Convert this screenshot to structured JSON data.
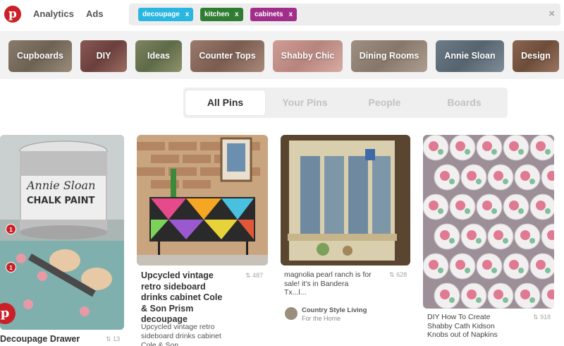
{
  "header": {
    "nav": [
      "Analytics",
      "Ads"
    ],
    "search_chips": [
      {
        "label": "decoupage",
        "color": "#29b6e0"
      },
      {
        "label": "kitchen",
        "color": "#2f7d32"
      },
      {
        "label": "cabinets",
        "color": "#a22e8c"
      }
    ],
    "chip_remove": "x",
    "clear": "×"
  },
  "guides": [
    "Cupboards",
    "DIY",
    "Ideas",
    "Counter Tops",
    "Shabby Chic",
    "Dining Rooms",
    "Annie Sloan",
    "Design"
  ],
  "tabs": [
    "All Pins",
    "Your Pins",
    "People",
    "Boards"
  ],
  "pins": [
    {
      "title": "Decoupage Drawer",
      "count": "13",
      "badges": [
        "1",
        "1"
      ],
      "paint_can": {
        "line1": "Annie Sloan",
        "line2": "CHALK PAINT"
      }
    },
    {
      "title": "Upcycled vintage retro sideboard drinks cabinet Cole & Son Prism decoupage",
      "count": "487",
      "desc": "Upcycled vintage retro sideboard drinks cabinet Cole & Son"
    },
    {
      "title": "magnolia pearl ranch is for sale! it's in Bandera Tx...l...",
      "count": "628",
      "board": "Country Style Living",
      "board_sub": "For the Home"
    },
    {
      "title": "DIY How To Create Shabby Cath Kidson Knobs out of Napkins",
      "count": "918"
    }
  ],
  "colors": {
    "pinterest_red": "#cb2027",
    "accent": "#cb2027"
  }
}
